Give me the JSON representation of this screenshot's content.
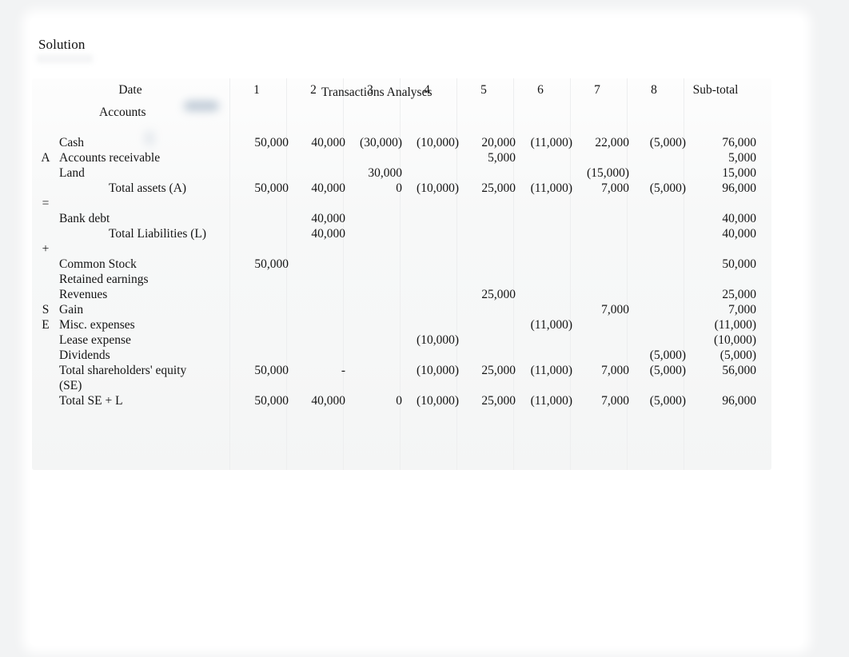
{
  "document": {
    "heading": "Solution"
  },
  "worksheet": {
    "title": "Transactions Analyses",
    "date_header": "Date",
    "accounts_header": "Accounts",
    "columns": [
      "1",
      "2",
      "3",
      "4",
      "5",
      "6",
      "7",
      "8"
    ],
    "subtotal_header": "Sub-total",
    "equation_marks": {
      "assets": "A",
      "equals": "=",
      "plus": "+",
      "se_line1": "S",
      "se_line2": "E"
    },
    "sections": {
      "assets": {
        "rows": [
          {
            "label": "Cash",
            "values": [
              "50,000",
              "40,000",
              "(30,000)",
              "(10,000)",
              "20,000",
              "(11,000)",
              "22,000",
              "(5,000)"
            ],
            "subtotal": "76,000"
          },
          {
            "label": "Accounts receivable",
            "values": [
              "",
              "",
              "",
              "",
              "5,000",
              "",
              "",
              ""
            ],
            "subtotal": "5,000"
          },
          {
            "label": "Land",
            "values": [
              "",
              "",
              "30,000",
              "",
              "",
              "",
              "(15,000)",
              ""
            ],
            "subtotal": "15,000"
          },
          {
            "label": "Total assets    (A)",
            "values": [
              "50,000",
              "40,000",
              "0",
              "(10,000)",
              "25,000",
              "(11,000)",
              "7,000",
              "(5,000)"
            ],
            "subtotal": "96,000"
          }
        ]
      },
      "liabilities": {
        "rows": [
          {
            "label": "Bank debt",
            "values": [
              "",
              "40,000",
              "",
              "",
              "",
              "",
              "",
              ""
            ],
            "subtotal": "40,000"
          },
          {
            "label": "Total Liabilities (L)",
            "values": [
              "",
              "40,000",
              "",
              "",
              "",
              "",
              "",
              ""
            ],
            "subtotal": "40,000"
          }
        ]
      },
      "equity": {
        "rows": [
          {
            "label": "Common Stock",
            "values": [
              "50,000",
              "",
              "",
              "",
              "",
              "",
              "",
              ""
            ],
            "subtotal": "50,000"
          },
          {
            "label": "Retained earnings",
            "values": [
              "",
              "",
              "",
              "",
              "",
              "",
              "",
              ""
            ],
            "subtotal": ""
          },
          {
            "label": "Revenues",
            "values": [
              "",
              "",
              "",
              "",
              "25,000",
              "",
              "",
              ""
            ],
            "subtotal": "25,000"
          },
          {
            "label": "Gain",
            "values": [
              "",
              "",
              "",
              "",
              "",
              "",
              "7,000",
              ""
            ],
            "subtotal": "7,000"
          },
          {
            "label": "Misc. expenses",
            "values": [
              "",
              "",
              "",
              "",
              "",
              "(11,000)",
              "",
              ""
            ],
            "subtotal": "(11,000)"
          },
          {
            "label": "Lease expense",
            "values": [
              "",
              "",
              "",
              "(10,000)",
              "",
              "",
              "",
              ""
            ],
            "subtotal": "(10,000)"
          },
          {
            "label": "Dividends",
            "values": [
              "",
              "",
              "",
              "",
              "",
              "",
              "",
              "(5,000)"
            ],
            "subtotal": "(5,000)"
          }
        ]
      },
      "totals": {
        "se_label_line1": "Total   shareholders' equity",
        "se_label_line2": "(SE)",
        "se_values": [
          "50,000",
          "-",
          "",
          "(10,000)",
          "25,000",
          "(11,000)",
          "7,000",
          "(5,000)"
        ],
        "se_subtotal": "56,000",
        "grand_label": "Total    SE + L",
        "grand_values": [
          "50,000",
          "40,000",
          "0",
          "(10,000)",
          "25,000",
          "(11,000)",
          "7,000",
          "(5,000)"
        ],
        "grand_subtotal": "96,000"
      }
    }
  }
}
